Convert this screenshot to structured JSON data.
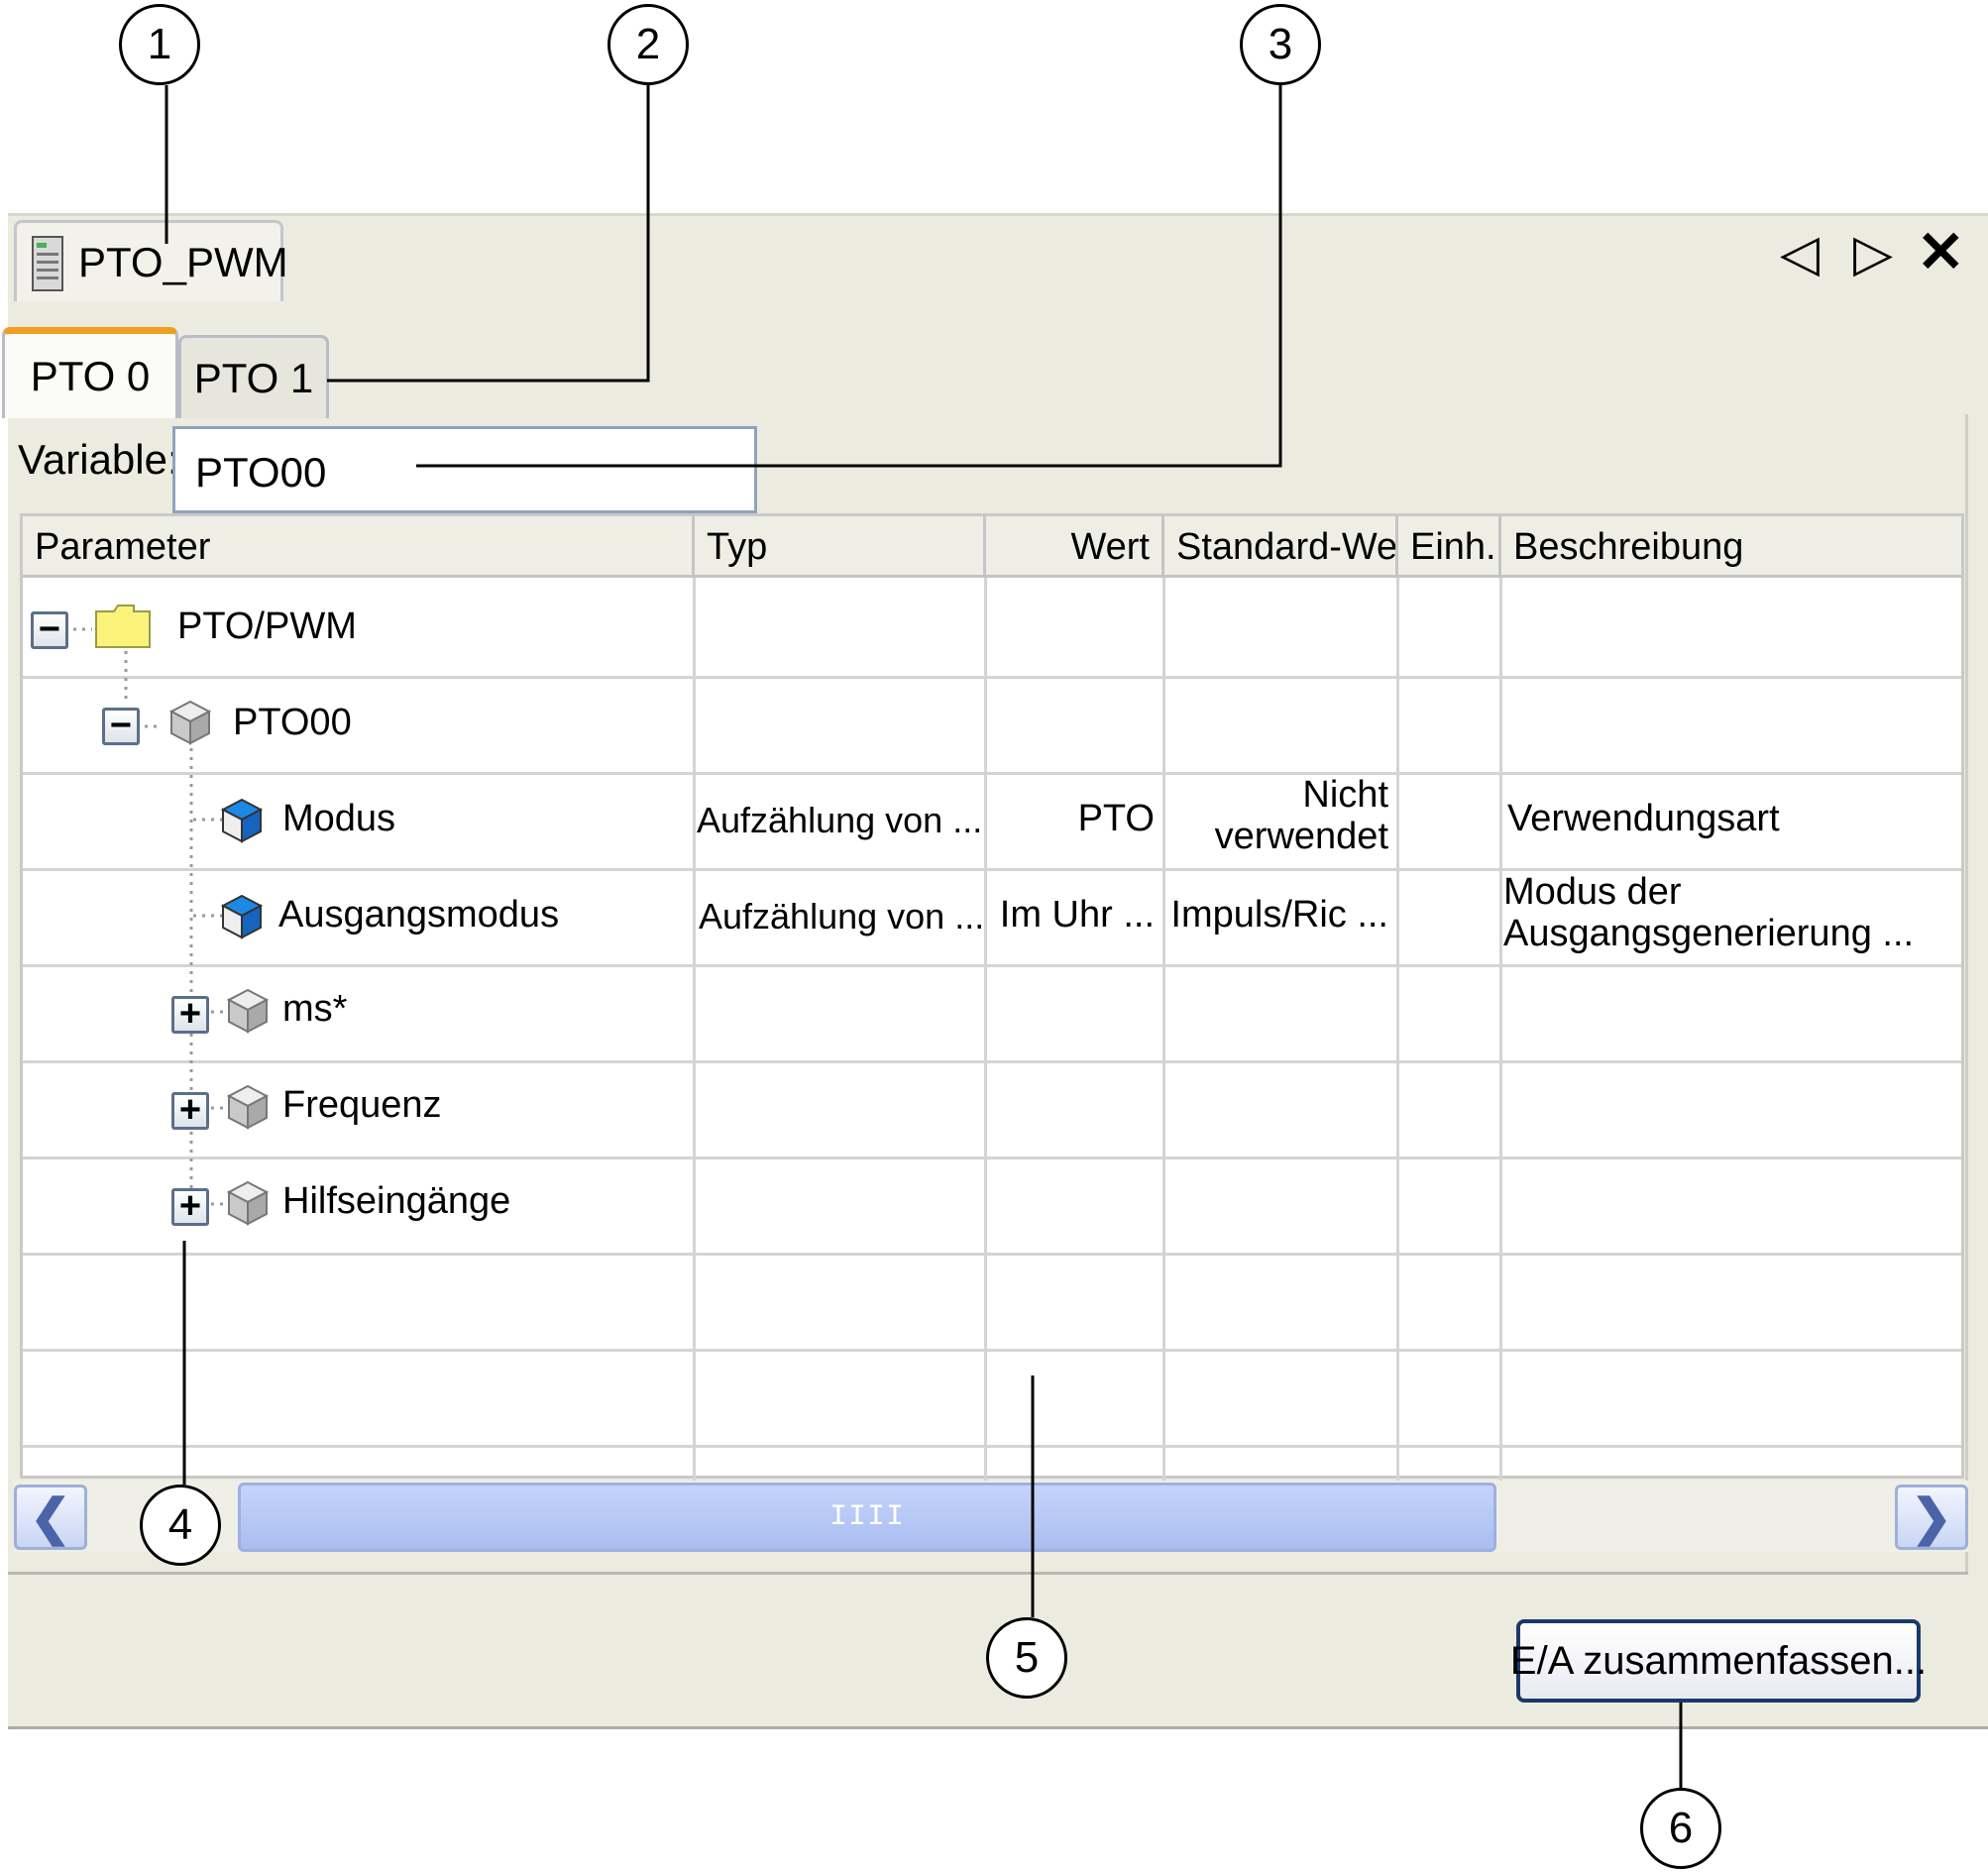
{
  "window": {
    "doc_tab_label": "PTO_PWM",
    "nav_prev": "◁",
    "nav_next": "▷",
    "close": "✕"
  },
  "tabs": [
    {
      "label": "PTO 0",
      "active": true
    },
    {
      "label": "PTO 1",
      "active": false
    }
  ],
  "variable": {
    "label": "Variable:",
    "value": "PTO00"
  },
  "columns": [
    "Parameter",
    "Typ",
    "Wert",
    "Standard-Wert",
    "Einh.",
    "Beschreibung"
  ],
  "rows": [
    {
      "name": "PTO/PWM",
      "icon": "folder-icon",
      "expander": "−",
      "typ": "",
      "wert": "",
      "standard_1": "",
      "standard_2": "",
      "einheit": "",
      "beschreibung_1": "",
      "beschreibung_2": ""
    },
    {
      "name": "PTO00",
      "icon": "cube-gray-icon",
      "expander": "−",
      "typ": "",
      "wert": "",
      "standard_1": "",
      "standard_2": "",
      "einheit": "",
      "beschreibung_1": "",
      "beschreibung_2": ""
    },
    {
      "name": "Modus",
      "icon": "cube-blue-icon",
      "expander": "",
      "typ": "Aufzählung von ...",
      "wert": "PTO",
      "standard_1": "Nicht",
      "standard_2": "verwendet",
      "einheit": "",
      "beschreibung_1": "Verwendungsart",
      "beschreibung_2": ""
    },
    {
      "name": "Ausgangsmodus",
      "icon": "cube-blue-icon",
      "expander": "",
      "typ": "Aufzählung von ...",
      "wert": "Im Uhr ...",
      "standard_1": "Impuls/Ric ...",
      "standard_2": "",
      "einheit": "",
      "beschreibung_1": "Modus der",
      "beschreibung_2": "Ausgangsgenerierung ..."
    },
    {
      "name": "ms*",
      "icon": "cube-gray-icon",
      "expander": "+",
      "typ": "",
      "wert": "",
      "standard_1": "",
      "standard_2": "",
      "einheit": "",
      "beschreibung_1": "",
      "beschreibung_2": ""
    },
    {
      "name": "Frequenz",
      "icon": "cube-gray-icon",
      "expander": "+",
      "typ": "",
      "wert": "",
      "standard_1": "",
      "standard_2": "",
      "einheit": "",
      "beschreibung_1": "",
      "beschreibung_2": ""
    },
    {
      "name": "Hilfseingänge",
      "icon": "cube-gray-icon",
      "expander": "+",
      "typ": "",
      "wert": "",
      "standard_1": "",
      "standard_2": "",
      "einheit": "",
      "beschreibung_1": "",
      "beschreibung_2": ""
    }
  ],
  "scrollbar": {
    "left": "❮",
    "right": "❯",
    "grip": "IIII"
  },
  "action_button": "E/A zusammenfassen...",
  "callouts": [
    "1",
    "2",
    "3",
    "4",
    "5",
    "6"
  ],
  "colors": {
    "panel": "#ecebe0",
    "active_tab_accent": "#f0a020",
    "folder": "#fbf27a",
    "cube_blue": "#1e88e5",
    "scroll_thumb": "#a9bdf0"
  }
}
